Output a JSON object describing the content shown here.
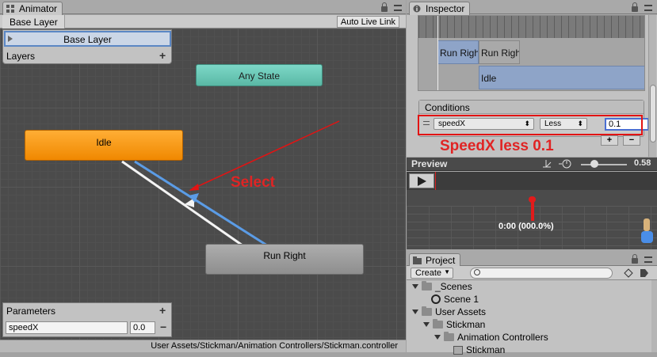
{
  "animator": {
    "tab_title": "Animator",
    "breadcrumb": "Base Layer",
    "auto_live_link": "Auto Live Link",
    "layers": {
      "selected_layer": "Base Layer",
      "header": "Layers",
      "add_symbol": "+"
    },
    "states": {
      "any_state": "Any State",
      "idle": "Idle",
      "run_right": "Run Right"
    },
    "parameters": {
      "header": "Parameters",
      "add_symbol": "+",
      "name": "speedX",
      "value": "0.0",
      "remove_symbol": "−"
    },
    "status_path": "User Assets/Stickman/Animation Controllers/Stickman.controller",
    "annotation": "Select"
  },
  "inspector": {
    "tab_title": "Inspector",
    "clips": {
      "clip_a": "Run Right",
      "clip_b": "Run Right",
      "clip_c": "Idle"
    },
    "conditions": {
      "header": "Conditions",
      "parameter": "speedX",
      "comparison": "Less",
      "threshold": "0.1",
      "add_symbol": "+",
      "remove_symbol": "−"
    },
    "annotation": "SpeedX less 0.1"
  },
  "preview": {
    "title": "Preview",
    "speed_value": "0.58",
    "timecode": "0:00 (000.0%)"
  },
  "project": {
    "tab_title": "Project",
    "create_label": "Create",
    "tree": [
      {
        "label": "_Scenes",
        "type": "folder",
        "indent": 0
      },
      {
        "label": "Scene 1",
        "type": "scene",
        "indent": 1
      },
      {
        "label": "User Assets",
        "type": "folder",
        "indent": 0
      },
      {
        "label": "Stickman",
        "type": "folder",
        "indent": 1
      },
      {
        "label": "Animation Controllers",
        "type": "folder",
        "indent": 2
      },
      {
        "label": "Stickman",
        "type": "controller",
        "indent": 3
      }
    ]
  },
  "colors": {
    "annotation_red": "#e02424",
    "idle_state": "#f59000",
    "any_state": "#6fcfbd",
    "selection_blue": "#5b87c4"
  }
}
